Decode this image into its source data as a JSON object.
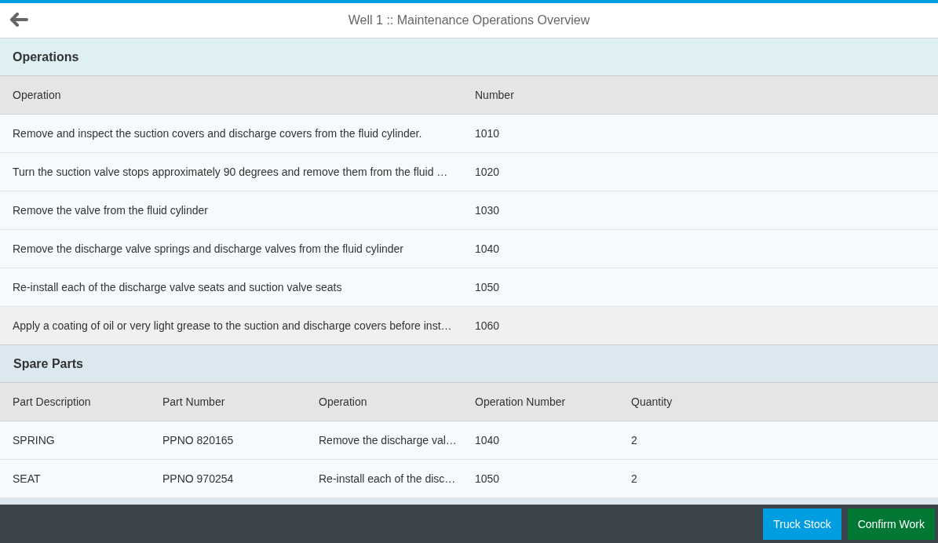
{
  "header": {
    "title": "Well 1 :: Maintenance Operations Overview"
  },
  "operations": {
    "title": "Operations",
    "columns": [
      "Operation",
      "Number"
    ],
    "rows": [
      {
        "cells": [
          "Remove and inspect the suction covers and discharge covers from the fluid cylinder.",
          "1010"
        ],
        "selected": false
      },
      {
        "cells": [
          "Turn the suction valve stops approximately 90 degrees and remove them from the fluid …",
          "1020"
        ],
        "selected": false
      },
      {
        "cells": [
          "Remove the valve from the fluid cylinder",
          "1030"
        ],
        "selected": false
      },
      {
        "cells": [
          "Remove the discharge valve springs and discharge valves from the fluid cylinder",
          "1040"
        ],
        "selected": false
      },
      {
        "cells": [
          "Re-install each of the discharge valve seats and suction valve seats",
          "1050"
        ],
        "selected": false
      },
      {
        "cells": [
          "Apply a coating of oil or very light grease to the suction and discharge covers before inst…",
          "1060"
        ],
        "selected": true
      }
    ]
  },
  "spare_parts": {
    "title": "Spare Parts",
    "columns": [
      "Part Description",
      "Part Number",
      "Operation",
      "Operation Number",
      "Quantity"
    ],
    "rows": [
      {
        "cells": [
          "SPRING",
          "PPNO 820165",
          "Remove the discharge val…",
          "1040",
          "2"
        ]
      },
      {
        "cells": [
          "SEAT",
          "PPNO 970254",
          "Re-install each of the disc…",
          "1050",
          "2"
        ]
      }
    ]
  },
  "footer": {
    "buttons": [
      {
        "label": "Truck Stock",
        "kind": "primary"
      },
      {
        "label": "Confirm Work",
        "kind": "accept"
      }
    ]
  }
}
